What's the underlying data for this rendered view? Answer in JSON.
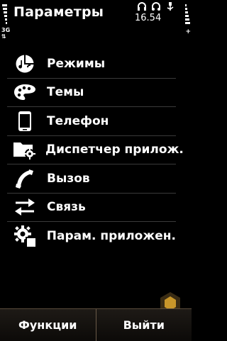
{
  "statusbar": {
    "title": "Параметры",
    "network": "3G",
    "network_arrows": "⇅",
    "time": "16.54",
    "indicators": [
      "headset-icon",
      "headphones-icon",
      "usb-icon"
    ]
  },
  "menu": {
    "items": [
      {
        "label": "Режимы",
        "icon": "profiles-icon"
      },
      {
        "label": "Темы",
        "icon": "palette-icon"
      },
      {
        "label": "Телефон",
        "icon": "phone-icon"
      },
      {
        "label": "Диспетчер прилож.",
        "icon": "app-manager-icon"
      },
      {
        "label": "Вызов",
        "icon": "call-icon"
      },
      {
        "label": "Связь",
        "icon": "connectivity-icon"
      },
      {
        "label": "Парам. приложен.",
        "icon": "app-settings-icon"
      }
    ]
  },
  "softkeys": {
    "left": "Функции",
    "right": "Выйти"
  },
  "colors": {
    "background": "#000000",
    "text": "#ffffff",
    "divider": "#3a3a3a",
    "softkey_bg": "#1e1a16"
  }
}
